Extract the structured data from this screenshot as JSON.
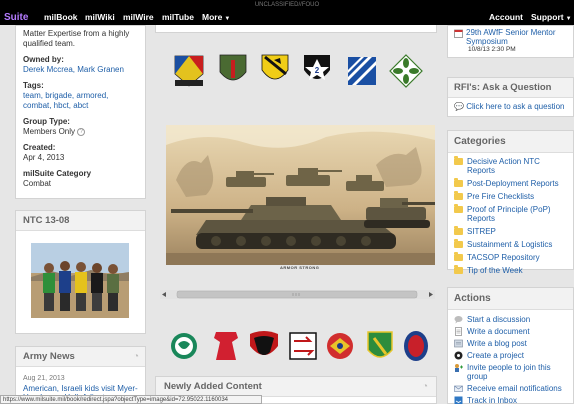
{
  "classification": "UNCLASSIFIED//FOUO",
  "nav": {
    "brand": "Suite",
    "items": [
      "milBook",
      "milWiki",
      "milWire",
      "milTube",
      "More"
    ],
    "account": "Account",
    "support": "Support"
  },
  "group_info": {
    "intro": "Matter Expertise from a highly qualified team.",
    "owned_by_label": "Owned by:",
    "owned_by": "Derek Mccrea, Mark Granen",
    "tags_label": "Tags:",
    "tags": "team, brigade, armored, combat, hbct, abct",
    "group_type_label": "Group Type:",
    "group_type": "Members Only",
    "created_label": "Created:",
    "created": "Apr 4, 2013",
    "category_label": "milSuite Category",
    "category": "Combat"
  },
  "ntc_panel": {
    "title": "NTC 13-08"
  },
  "army_news": {
    "title": "Army News",
    "date": "Aug 21, 2013",
    "headline": "American, Israeli kids visit Myer-Henderson Hall, Arlington"
  },
  "hero": {
    "caption": "ARMOR STRONG"
  },
  "newly_added": {
    "title": "Newly Added Content"
  },
  "event": {
    "title": "29th AWfF Senior Mentor Symposium",
    "time": "10/8/13 2:30 PM"
  },
  "rfi": {
    "title": "RFI's: Ask a Question",
    "link": "Click here to ask a question"
  },
  "categories": {
    "title": "Categories",
    "items": [
      "Decisive Action NTC Reports",
      "Post-Deployment Reports",
      "Pre Fire Checklists",
      "Proof of Principle (PoP) Reports",
      "SITREP",
      "Sustainment & Logistics",
      "TACSOP Repository",
      "Tip of the Week"
    ]
  },
  "actions": {
    "title": "Actions",
    "items": [
      {
        "label": "Start a discussion",
        "icon": "discussion-icon"
      },
      {
        "label": "Write a document",
        "icon": "document-icon"
      },
      {
        "label": "Write a blog post",
        "icon": "blog-icon"
      },
      {
        "label": "Create a project",
        "icon": "project-icon"
      },
      {
        "label": "Invite people to join this group",
        "icon": "invite-icon"
      },
      {
        "label": "Receive email notifications",
        "icon": "email-icon"
      },
      {
        "label": "Track in Inbox",
        "icon": "inbox-icon"
      }
    ]
  },
  "status_url": "https://www.milsuite.mil/book/redirect.jspa?objectType=image&id=72.95022.1160034"
}
